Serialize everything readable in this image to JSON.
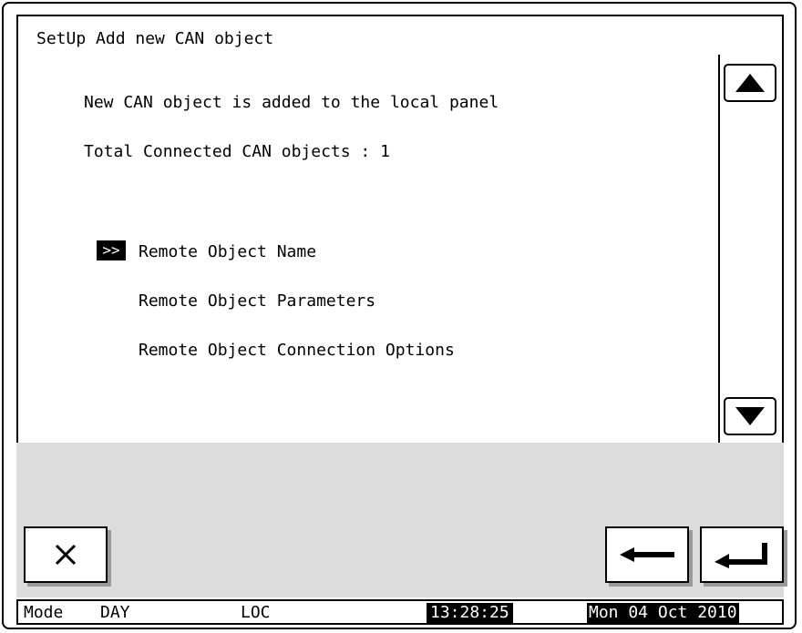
{
  "window": {
    "title": "SetUp Add new CAN object"
  },
  "content": {
    "message": "New CAN object is added to the local panel",
    "total_line": "Total Connected CAN objects : 1",
    "cursor_marker": ">>",
    "menu_items": [
      {
        "label": "Remote Object Name",
        "selected": true
      },
      {
        "label": "Remote Object Parameters",
        "selected": false
      },
      {
        "label": "Remote Object Connection Options",
        "selected": false
      }
    ]
  },
  "scroll": {
    "up_icon": "triangle-up-icon",
    "down_icon": "triangle-down-icon"
  },
  "buttons": {
    "close_icon": "close-x-icon",
    "back_icon": "arrow-left-icon",
    "enter_icon": "enter-return-icon"
  },
  "status_bar": {
    "mode_label": "Mode",
    "mode_value": "DAY",
    "location": "LOC",
    "time": "13:28:25",
    "date": "Mon 04 Oct 2010"
  }
}
